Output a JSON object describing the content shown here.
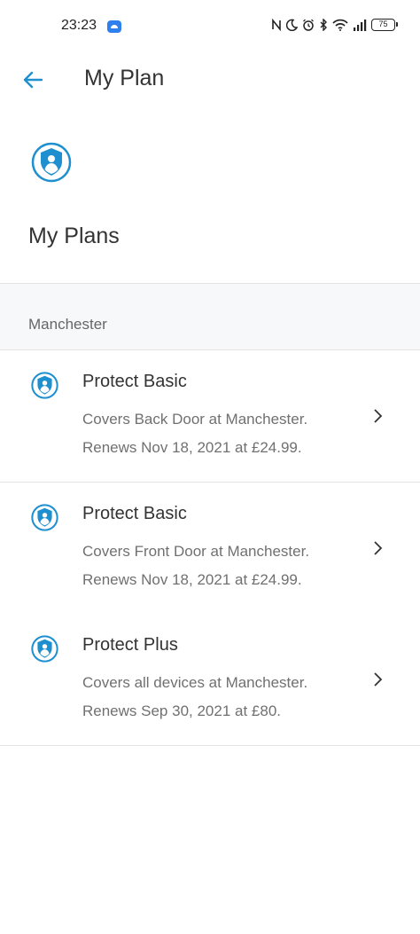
{
  "status_bar": {
    "time": "23:23",
    "battery_level": "75",
    "icons": [
      "nfc-icon",
      "moon-icon",
      "alarm-icon",
      "bluetooth-icon",
      "wifi-icon",
      "signal-icon",
      "battery-icon"
    ]
  },
  "header": {
    "title": "My Plan",
    "back_icon": "arrow-left-icon"
  },
  "section": {
    "title": "My Plans",
    "icon": "shield-user-icon"
  },
  "group": {
    "location": "Manchester"
  },
  "plans": [
    {
      "name": "Protect Basic",
      "coverage": "Covers Back Door at Manchester.",
      "renewal": "Renews Nov 18, 2021 at £24.99."
    },
    {
      "name": "Protect Basic",
      "coverage": "Covers Front Door at Manchester.",
      "renewal": "Renews Nov 18, 2021 at £24.99."
    },
    {
      "name": "Protect Plus",
      "coverage": "Covers all devices at Manchester.",
      "renewal": "Renews Sep 30, 2021 at £80."
    }
  ],
  "colors": {
    "accent": "#1e8fcf",
    "text": "#333333",
    "muted": "#707070",
    "group_bg": "#f7f8fa",
    "divider": "#e3e3e3"
  }
}
